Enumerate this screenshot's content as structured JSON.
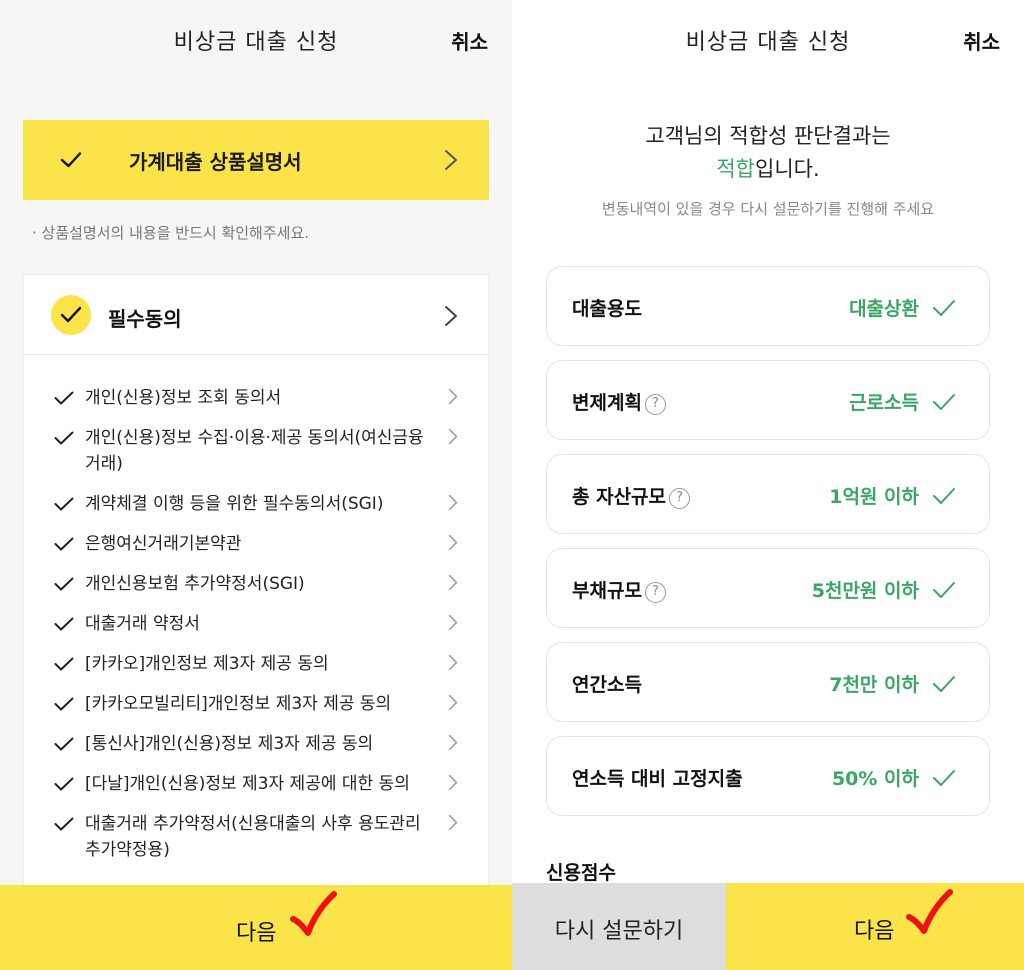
{
  "left": {
    "header": {
      "title": "비상금 대출 신청",
      "cancel": "취소"
    },
    "product_doc": {
      "label": "가계대출 상품설명서"
    },
    "note": "· 상품설명서의 내용을 반드시 확인해주세요.",
    "required_consent": {
      "label": "필수동의",
      "items": [
        "개인(신용)정보 조회 동의서",
        "개인(신용)정보 수집·이용·제공 동의서(여신금융거래)",
        "계약체결 이행 등을 위한 필수동의서(SGI)",
        "은행여신거래기본약관",
        "개인신용보험 추가약정서(SGI)",
        "대출거래 약정서",
        "[카카오]개인정보 제3자 제공 동의",
        "[카카오모빌리티]개인정보 제3자 제공 동의",
        "[통신사]개인(신용)정보 제3자 제공 동의",
        "[다날]개인(신용)정보 제3자 제공에 대한 동의",
        "대출거래 추가약정서(신용대출의 사후 용도관리 추가약정용)"
      ]
    },
    "next_button": "다음"
  },
  "right": {
    "header": {
      "title": "비상금 대출 신청",
      "cancel": "취소"
    },
    "result": {
      "line1": "고객님의 적합성 판단결과는",
      "highlight": "적합",
      "suffix": "입니다.",
      "sub": "변동내역이 있을 경우 다시 설문하기를 진행해 주세요"
    },
    "rows": [
      {
        "label": "대출용도",
        "value": "대출상환"
      },
      {
        "label": "변제계획",
        "value": "근로소득",
        "help": "?"
      },
      {
        "label": "총 자산규모",
        "value": "1억원 이하",
        "help": "?"
      },
      {
        "label": "부채규모",
        "value": "5천만원 이하",
        "help": "?"
      },
      {
        "label": "연간소득",
        "value": "7천만 이하"
      },
      {
        "label": "연소득 대비 고정지출",
        "value": "50% 이하"
      }
    ],
    "credit_score_label": "신용점수",
    "retry_button": "다시 설문하기",
    "next_button": "다음"
  },
  "colors": {
    "accent_yellow": "#fbe34a",
    "success_green": "#3ba567",
    "annotation_red": "#e11"
  },
  "icons": [
    "check-icon",
    "chevron-right-icon",
    "help-icon",
    "red-checkmark-icon"
  ]
}
